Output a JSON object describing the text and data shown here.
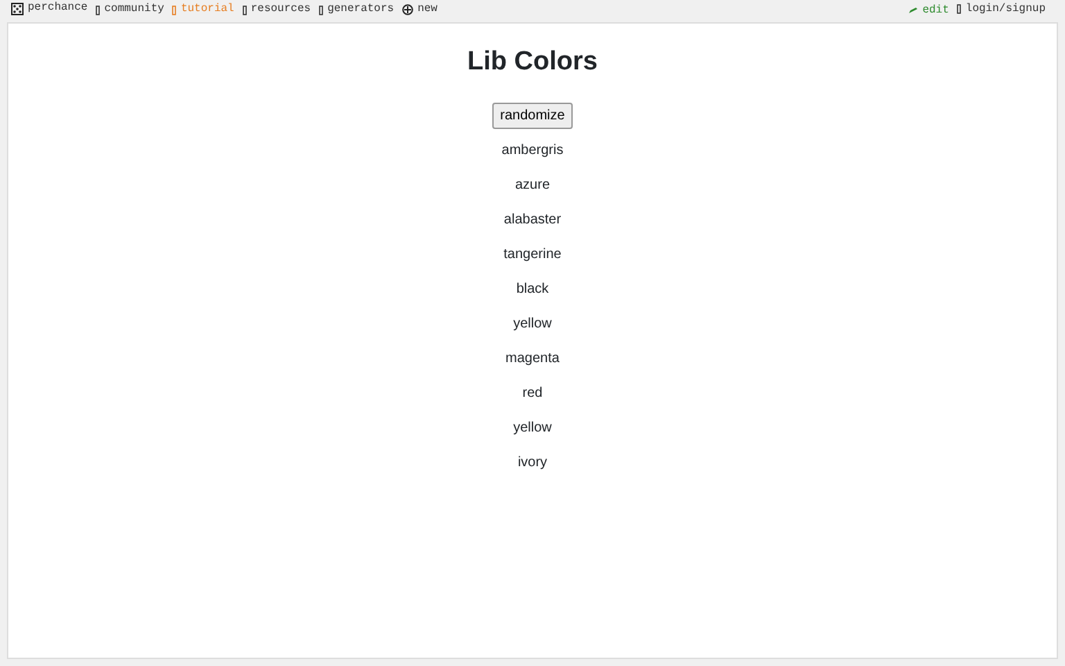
{
  "top_bar": {
    "left_links": [
      {
        "label": "perchance",
        "kind": "dice",
        "color": "#333333"
      },
      {
        "label": "community",
        "kind": "box",
        "color": "#333333"
      },
      {
        "label": "tutorial",
        "kind": "box",
        "color": "#e67e22"
      },
      {
        "label": "resources",
        "kind": "box",
        "color": "#333333"
      },
      {
        "label": "generators",
        "kind": "box",
        "color": "#333333"
      },
      {
        "label": "new",
        "kind": "plus",
        "color": "#333333"
      }
    ],
    "right_links": [
      {
        "label": "edit",
        "kind": "pencil",
        "color": "#2e8b2e"
      },
      {
        "label": "login/signup",
        "kind": "box",
        "color": "#333333"
      }
    ]
  },
  "page": {
    "title": "Lib Colors",
    "button": "randomize",
    "items": [
      "ambergris",
      "azure",
      "alabaster",
      "tangerine",
      "black",
      "yellow",
      "magenta",
      "red",
      "yellow",
      "ivory"
    ]
  }
}
